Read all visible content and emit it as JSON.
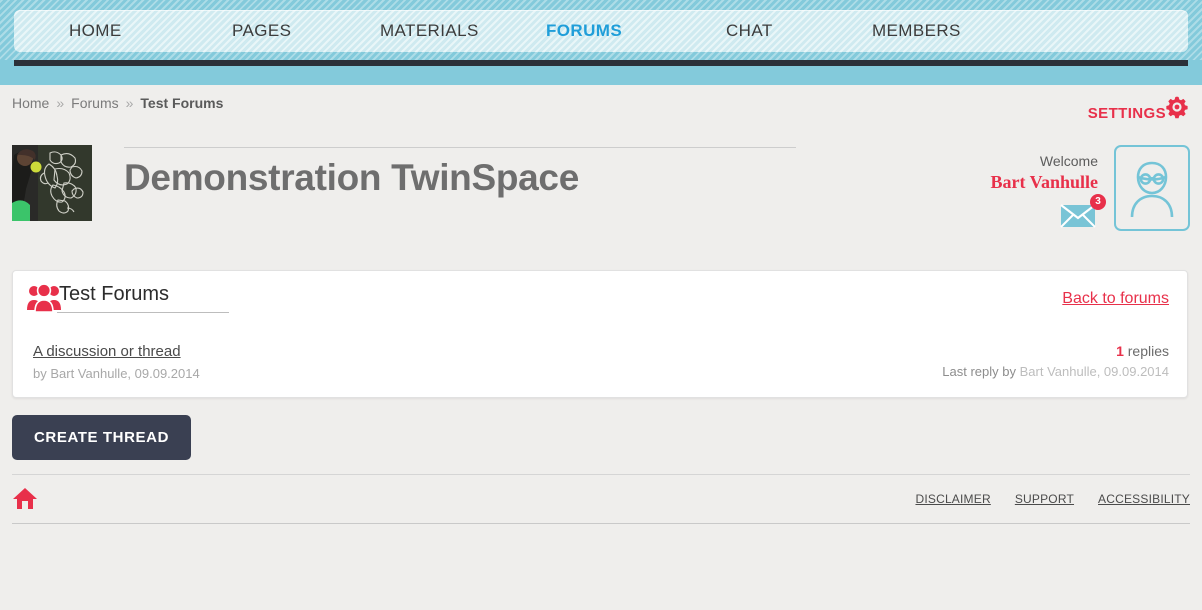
{
  "nav": {
    "items": [
      {
        "label": "HOME",
        "active": false,
        "name": "nav-item-home"
      },
      {
        "label": "PAGES",
        "active": false,
        "name": "nav-item-pages"
      },
      {
        "label": "MATERIALS",
        "active": false,
        "name": "nav-item-materials"
      },
      {
        "label": "FORUMS",
        "active": true,
        "name": "nav-item-forums"
      },
      {
        "label": "CHAT",
        "active": false,
        "name": "nav-item-chat"
      },
      {
        "label": "MEMBERS",
        "active": false,
        "name": "nav-item-members"
      }
    ]
  },
  "breadcrumb": {
    "home": "Home",
    "forums": "Forums",
    "current": "Test Forums",
    "separator": "»"
  },
  "settings": {
    "label": "SETTINGS",
    "icon": "gear-icon"
  },
  "header": {
    "space_title": "Demonstration TwinSpace",
    "thumbnail_alt": "chalkboard-europe-map-photo"
  },
  "user": {
    "welcome_label": "Welcome",
    "name": "Bart Vanhulle",
    "messages_badge": "3",
    "mail_icon": "envelope-icon",
    "avatar_icon": "user-avatar-icon"
  },
  "forum_panel": {
    "icon": "group-people-icon",
    "forum_name": "Test Forums",
    "back_link": "Back to forums",
    "thread": {
      "title": "A discussion or thread",
      "meta": "by Bart Vanhulle, 09.09.2014",
      "replies_count": "1",
      "replies_label": "replies",
      "last_reply_prefix": "Last reply by",
      "last_reply_author": "Bart Vanhulle, 09.09.2014"
    }
  },
  "actions": {
    "create_thread": "CREATE THREAD"
  },
  "footer": {
    "home_icon": "house-icon",
    "links": [
      {
        "label": "DISCLAIMER",
        "name": "footer-link-disclaimer"
      },
      {
        "label": "SUPPORT",
        "name": "footer-link-support"
      },
      {
        "label": "ACCESSIBILITY",
        "name": "footer-link-accessibility"
      }
    ]
  },
  "colors": {
    "teal": "#83cadb",
    "teal_light": "#cfeaf0",
    "accent_red": "#e8304a",
    "active_blue": "#1f9ed9",
    "dark_bar": "#2b3139",
    "button_navy": "#3a4052",
    "page_bg": "#efeeec"
  }
}
